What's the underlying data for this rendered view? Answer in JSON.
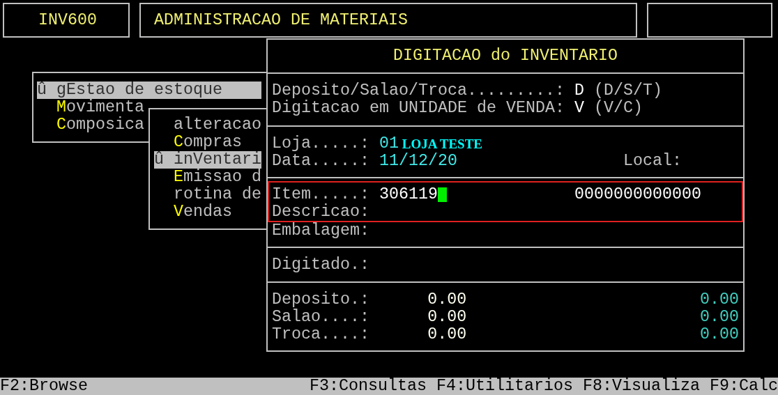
{
  "header": {
    "program_code": "INV600",
    "system_title": "ADMINISTRACAO DE MATERIAIS"
  },
  "menus": [
    {
      "items": [
        {
          "marker": "û",
          "lead": "g",
          "hotkey": "E",
          "rest": "stao de estoque",
          "selected": true
        },
        {
          "hotkey": "M",
          "rest": "ovimenta",
          "selected": false
        },
        {
          "hotkey": "C",
          "rest": "omposica",
          "selected": false
        }
      ]
    },
    {
      "items": [
        {
          "lead": "alteracao",
          "selected": false
        },
        {
          "hotkey": "C",
          "rest": "ompras",
          "selected": false
        },
        {
          "marker": "û",
          "lead": "in",
          "hotkey": "V",
          "rest": "entari",
          "selected": true
        },
        {
          "hotkey": "E",
          "rest": "missao d",
          "selected": false
        },
        {
          "lead": "rotina de",
          "selected": false
        },
        {
          "hotkey": "V",
          "rest": "endas",
          "selected": false
        }
      ]
    }
  ],
  "dialog": {
    "title": "DIGITACAO do INVENTARIO",
    "options": [
      {
        "label": "Deposito/Salao/Troca.........:",
        "value": "D",
        "choices": "(D/S/T)"
      },
      {
        "label": "Digitacao em UNIDADE de VENDA:",
        "value": "V",
        "choices": "(V/C)"
      }
    ],
    "store": {
      "label": "Loja.....:",
      "code": "01",
      "name": "LOJA TESTE"
    },
    "date": {
      "label": "Data.....:",
      "value": "11/12/20"
    },
    "location": {
      "label": "Local:"
    },
    "item": {
      "label": "Item.....:",
      "value": "306119",
      "barcode": "0000000000000"
    },
    "description": {
      "label": "Descricao:"
    },
    "packaging": {
      "label": "Embalagem:"
    },
    "typed": {
      "label": "Digitado.:"
    },
    "totals": [
      {
        "label": "Deposito.:",
        "column_2": "0.00",
        "column_3": "0.00"
      },
      {
        "label": "Salao....:",
        "column_2": "0.00",
        "column_3": "0.00"
      },
      {
        "label": "Troca....:",
        "column_2": "0.00",
        "column_3": "0.00"
      }
    ]
  },
  "status_bar": {
    "left": [
      "F2:Browse"
    ],
    "right": [
      "F3:Consultas",
      "F4:Utilitarios",
      "F8:Visualiza",
      "F9:Calc"
    ]
  }
}
